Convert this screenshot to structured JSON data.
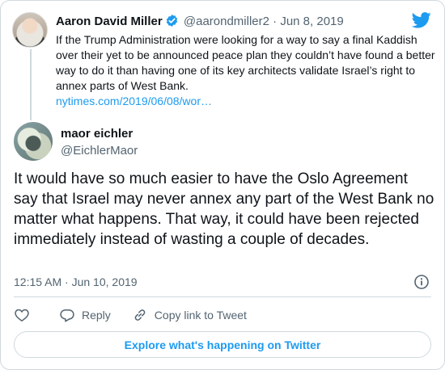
{
  "quoted_tweet": {
    "author_name": "Aaron David Miller",
    "handle": "@aarondmiller2",
    "separator": "·",
    "date": "Jun 8, 2019",
    "text": "If the Trump Administration were looking for a way to say a final Kaddish over their yet to be announced peace plan they couldn’t have found a better way to do it than having one of its key architects validate Israel’s right to annex parts of West Bank.",
    "link": "nytimes.com/2019/06/08/wor…"
  },
  "tweet": {
    "author_name": "maor eichler",
    "handle": "@EichlerMaor",
    "text": "It would have so much easier to have the Oslo Agreement say that Israel may never annex any part of the West Bank no matter what happens. That way, it could have been rejected immediately instead of wasting a couple of decades.",
    "timestamp": "12:15 AM · Jun 10, 2019"
  },
  "actions": {
    "like_icon": "heart-icon",
    "reply_label": "Reply",
    "copy_link_label": "Copy link to Tweet"
  },
  "explore_label": "Explore what's happening on Twitter",
  "colors": {
    "accent": "#1d9bf0",
    "text": "#0f1419",
    "secondary_text": "#536471",
    "border": "#cfd9de"
  }
}
